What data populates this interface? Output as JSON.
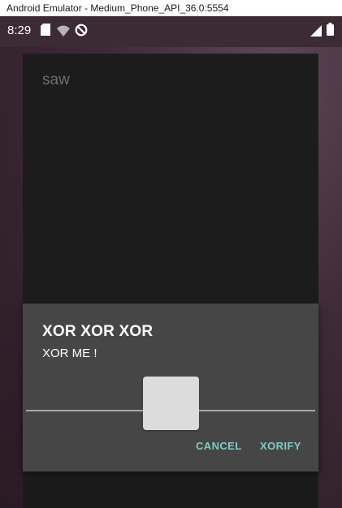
{
  "window": {
    "title": "Android Emulator - Medium_Phone_API_36.0:5554"
  },
  "status_bar": {
    "time": "8:29",
    "left_icons": [
      "sd-card-icon",
      "wifi-icon",
      "do-not-disturb-icon"
    ],
    "right_icons": [
      "signal-icon",
      "battery-icon"
    ]
  },
  "app": {
    "label": "saw"
  },
  "dialog": {
    "title": "XOR XOR XOR",
    "message": "XOR ME !",
    "cancel_label": "CANCEL",
    "confirm_label": "XORIFY",
    "accent_color": "#80cbc4",
    "background_color": "#464646"
  }
}
